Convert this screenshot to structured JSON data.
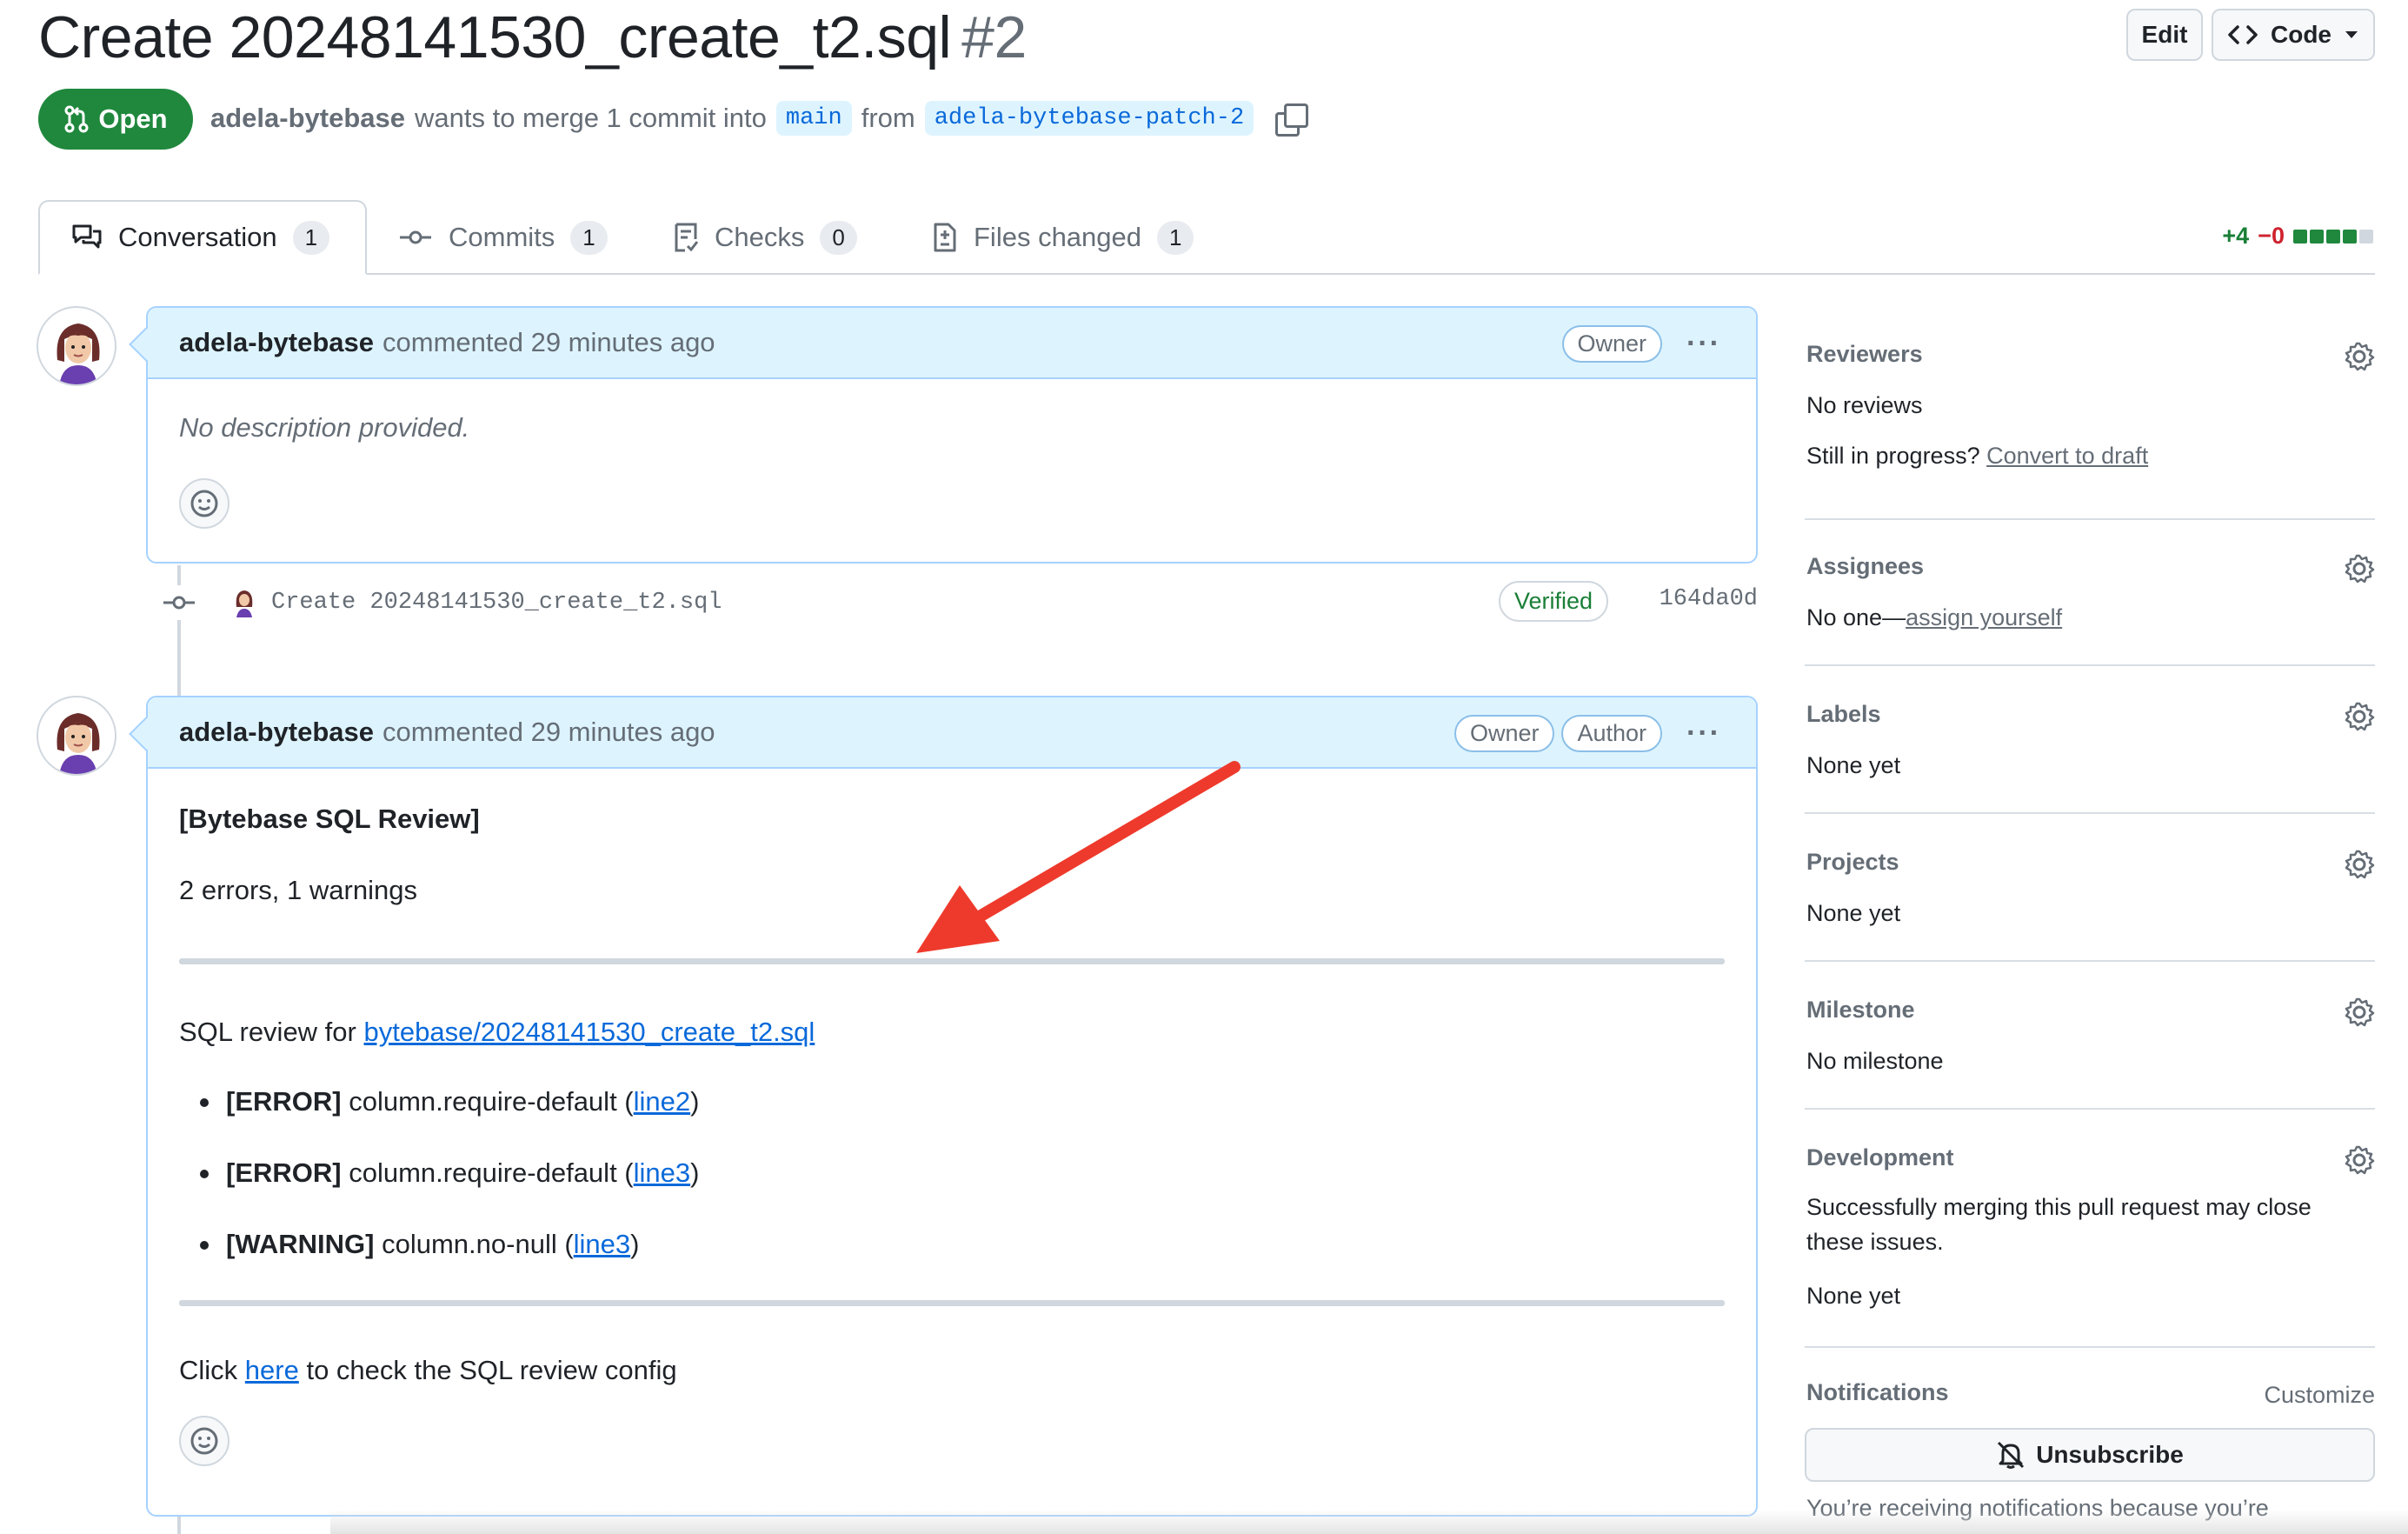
{
  "pr": {
    "title": "Create 20248141530_create_t2.sql",
    "number": "#2",
    "state": "Open",
    "author": "adela-bytebase",
    "merge_text": "wants to merge 1 commit into",
    "base_branch": "main",
    "from_text": "from",
    "head_branch": "adela-bytebase-patch-2"
  },
  "header": {
    "edit_label": "Edit",
    "code_label": "Code"
  },
  "tabs": [
    {
      "label": "Conversation",
      "count": "1"
    },
    {
      "label": "Commits",
      "count": "1"
    },
    {
      "label": "Checks",
      "count": "0"
    },
    {
      "label": "Files changed",
      "count": "1"
    }
  ],
  "diffstat": {
    "additions": "+4",
    "deletions": "−0"
  },
  "comment1": {
    "author": "adela-bytebase",
    "action": "commented 29 minutes ago",
    "badge_owner": "Owner",
    "body": "No description provided."
  },
  "commit": {
    "message": "Create 20248141530_create_t2.sql",
    "verified": "Verified",
    "sha": "164da0d"
  },
  "comment2": {
    "author": "adela-bytebase",
    "action": "commented 29 minutes ago",
    "badge_owner": "Owner",
    "badge_author": "Author",
    "heading": "[Bytebase SQL Review]",
    "summary": "2 errors, 1 warnings",
    "review_prefix": "SQL review for",
    "review_file": "bytebase/20248141530_create_t2.sql",
    "issues": [
      {
        "level": "[ERROR]",
        "rule": "column.require-default",
        "link": "line2"
      },
      {
        "level": "[ERROR]",
        "rule": "column.require-default",
        "link": "line3"
      },
      {
        "level": "[WARNING]",
        "rule": "column.no-null",
        "link": "line3"
      }
    ],
    "footer_prefix": "Click",
    "footer_link": "here",
    "footer_suffix": "to check the SQL review config"
  },
  "sidebar": {
    "reviewers": {
      "title": "Reviewers",
      "value": "No reviews",
      "hint": "Still in progress?",
      "hint_link": "Convert to draft"
    },
    "assignees": {
      "title": "Assignees",
      "value": "No one—",
      "value_link": "assign yourself"
    },
    "labels": {
      "title": "Labels",
      "value": "None yet"
    },
    "projects": {
      "title": "Projects",
      "value": "None yet"
    },
    "milestone": {
      "title": "Milestone",
      "value": "No milestone"
    },
    "development": {
      "title": "Development",
      "description": "Successfully merging this pull request may close these issues.",
      "value": "None yet"
    },
    "notifications": {
      "title": "Notifications",
      "customize": "Customize",
      "button": "Unsubscribe",
      "note": "You’re receiving notifications because you’re"
    }
  },
  "colors": {
    "open_green": "#1f883d",
    "link_blue": "#0969da",
    "comment_header_bg": "#ddf4ff",
    "annotation_arrow": "#ee3a2c"
  }
}
